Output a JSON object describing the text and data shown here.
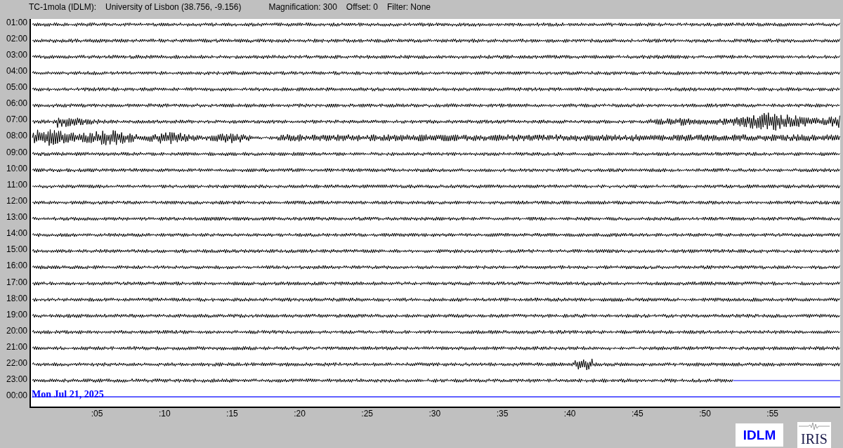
{
  "header": {
    "station": "TC-1mola (IDLM):",
    "location": "University of Lisbon (38.756, -9.156)",
    "magnification": "Magnification: 300",
    "offset": "Offset: 0",
    "filter": "Filter: None"
  },
  "helicorder": {
    "hours": [
      "01:00",
      "02:00",
      "03:00",
      "04:00",
      "05:00",
      "06:00",
      "07:00",
      "08:00",
      "09:00",
      "10:00",
      "11:00",
      "12:00",
      "13:00",
      "14:00",
      "15:00",
      "16:00",
      "17:00",
      "18:00",
      "19:00",
      "20:00",
      "21:00",
      "22:00",
      "23:00",
      "00:00"
    ],
    "date": "Mon Jul 21, 2025",
    "minute_ticks": [
      ":05",
      ":10",
      ":15",
      ":20",
      ":25",
      ":30",
      ":35",
      ":40",
      ":45",
      ":50",
      ":55"
    ]
  },
  "logos": {
    "station": "IDLM",
    "network": "IRIS"
  }
}
